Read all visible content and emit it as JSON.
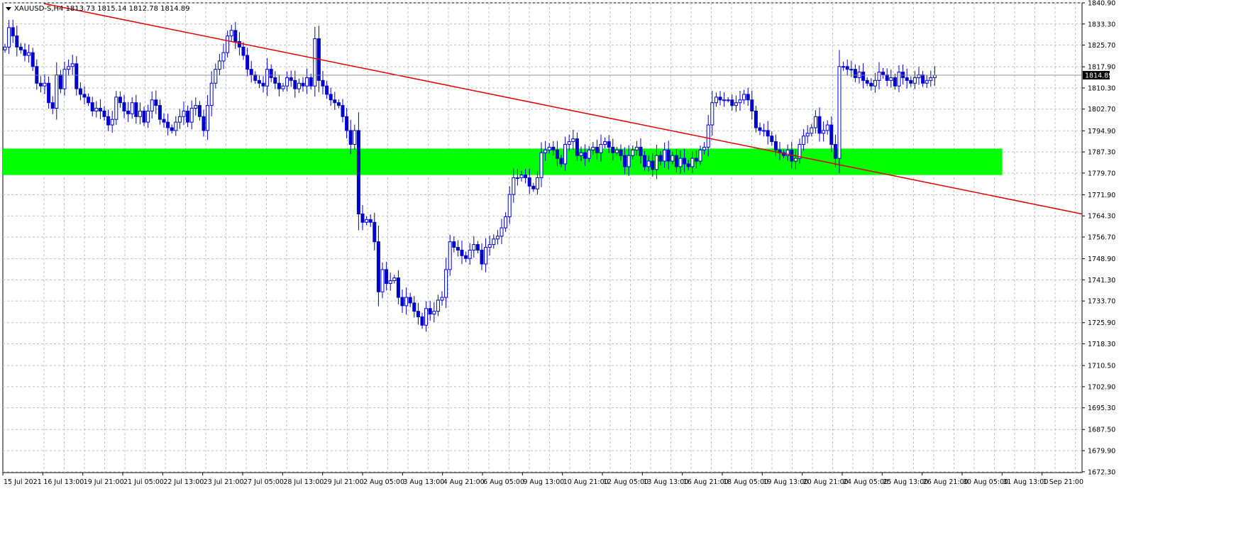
{
  "window": {
    "symbol_info": "XAUUSD-S,H4  1813.73 1815.14 1812.78 1814.89"
  },
  "colors": {
    "background": "#ffffff",
    "grid": "#b8c0c8",
    "candle": "#0000cc",
    "trendline": "#e00000",
    "zone": "#00ff00",
    "axis_text": "#000000",
    "price_marker_bg": "#000000",
    "price_marker_text": "#ffffff"
  },
  "chart_data": {
    "type": "candlestick",
    "symbol": "XAUUSD-S",
    "timeframe": "H4",
    "ohlc_current": {
      "open": 1813.73,
      "high": 1815.14,
      "low": 1812.78,
      "close": 1814.89
    },
    "current_price_label": "1814.89",
    "ylim": [
      1672.0,
      1840.9
    ],
    "price_ticks": [
      "1840.90",
      "1833.30",
      "1825.70",
      "1817.90",
      "1810.30",
      "1802.70",
      "1794.90",
      "1787.30",
      "1779.70",
      "1771.90",
      "1764.30",
      "1756.70",
      "1748.90",
      "1741.30",
      "1733.70",
      "1725.90",
      "1718.30",
      "1710.50",
      "1702.90",
      "1695.30",
      "1687.50",
      "1679.90",
      "1672.30"
    ],
    "time_ticks": [
      "15 Jul 2021",
      "16 Jul 13:00",
      "19 Jul 21:00",
      "21 Jul 05:00",
      "22 Jul 13:00",
      "23 Jul 21:00",
      "27 Jul 05:00",
      "28 Jul 13:00",
      "29 Jul 21:00",
      "2 Aug 05:00",
      "3 Aug 13:00",
      "4 Aug 21:00",
      "6 Aug 05:00",
      "9 Aug 13:00",
      "10 Aug 21:00",
      "12 Aug 05:00",
      "13 Aug 13:00",
      "16 Aug 21:00",
      "18 Aug 05:00",
      "19 Aug 13:00",
      "20 Aug 21:00",
      "24 Aug 05:00",
      "25 Aug 13:00",
      "26 Aug 21:00",
      "30 Aug 05:00",
      "31 Aug 13:00",
      "1 Sep 21:00"
    ],
    "trendline": {
      "from": {
        "bar": 0,
        "price": 1843.5
      },
      "to": {
        "bar": 270,
        "price": 1765.0
      }
    },
    "zone": {
      "from_bar": 0,
      "to_bar": 251,
      "price_high": 1788.5,
      "price_low": 1779.0
    },
    "closes": [
      1825,
      1832,
      1829,
      1825,
      1824,
      1822,
      1823,
      1818,
      1812,
      1811,
      1812,
      1805,
      1803,
      1815,
      1810,
      1817,
      1818,
      1819,
      1810,
      1808,
      1807,
      1805,
      1802,
      1803,
      1802,
      1800,
      1797,
      1799,
      1807,
      1805,
      1802,
      1801,
      1805,
      1800,
      1802,
      1798,
      1802,
      1806,
      1804,
      1799,
      1798,
      1796,
      1795,
      1798,
      1800,
      1802,
      1798,
      1803,
      1804,
      1800,
      1795,
      1804,
      1812,
      1817,
      1820,
      1823,
      1829,
      1831,
      1827,
      1825,
      1822,
      1817,
      1815,
      1813,
      1812,
      1811,
      1817,
      1814,
      1812,
      1810,
      1811,
      1814,
      1813,
      1810,
      1812,
      1811,
      1814,
      1811,
      1828,
      1813,
      1811,
      1808,
      1806,
      1805,
      1804,
      1800,
      1795,
      1790,
      1795,
      1765,
      1762,
      1763,
      1762,
      1755,
      1737,
      1745,
      1740,
      1741,
      1742,
      1735,
      1732,
      1735,
      1733,
      1730,
      1728,
      1725,
      1731,
      1729,
      1730,
      1734,
      1735,
      1745,
      1755,
      1753,
      1752,
      1750,
      1749,
      1752,
      1754,
      1752,
      1747,
      1753,
      1754,
      1756,
      1757,
      1760,
      1764,
      1772,
      1778,
      1778,
      1779,
      1778,
      1775,
      1774,
      1778,
      1787,
      1788,
      1789,
      1788,
      1785,
      1783,
      1790,
      1791,
      1792,
      1786,
      1787,
      1785,
      1788,
      1789,
      1787,
      1790,
      1791,
      1789,
      1787,
      1788,
      1786,
      1782,
      1786,
      1788,
      1789,
      1786,
      1782,
      1784,
      1781,
      1786,
      1784,
      1788,
      1784,
      1786,
      1782,
      1785,
      1783,
      1782,
      1785,
      1784,
      1788,
      1789,
      1797,
      1805,
      1807,
      1806,
      1806,
      1806,
      1804,
      1805,
      1806,
      1808,
      1806,
      1802,
      1796,
      1795,
      1795,
      1793,
      1791,
      1788,
      1787,
      1786,
      1788,
      1784,
      1785,
      1790,
      1793,
      1794,
      1796,
      1800,
      1794,
      1795,
      1797,
      1790,
      1785,
      1818,
      1818,
      1817,
      1817,
      1814,
      1816,
      1813,
      1812,
      1811,
      1813,
      1816,
      1815,
      1813,
      1814,
      1811,
      1816,
      1814,
      1813,
      1812,
      1814,
      1815,
      1812,
      1813,
      1814,
      1814.89
    ]
  }
}
